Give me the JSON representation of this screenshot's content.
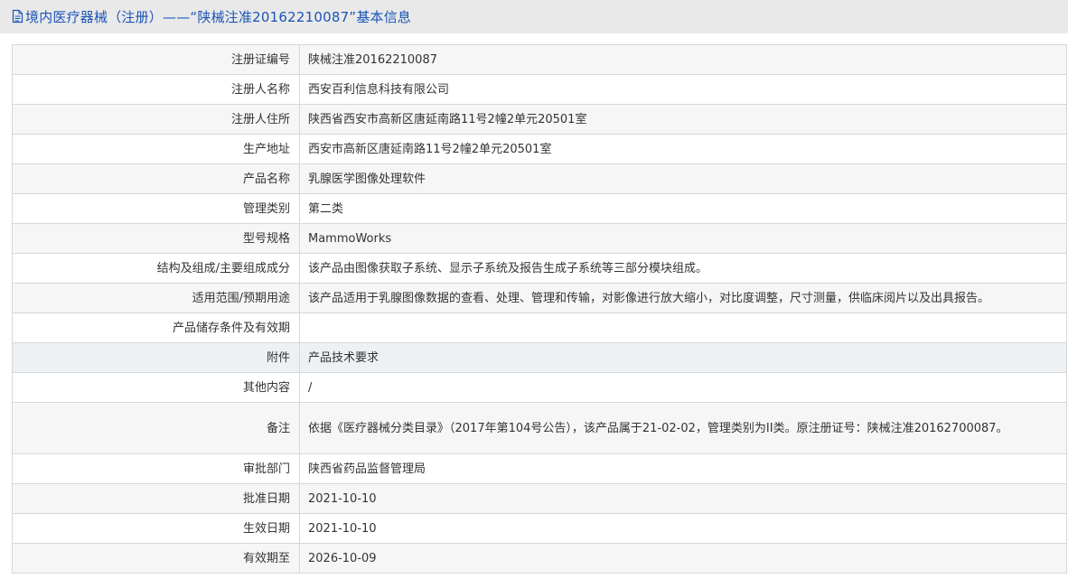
{
  "header": {
    "icon": "document-icon",
    "title": "境内医疗器械（注册）——“陕械注准20162210087”基本信息"
  },
  "rows": [
    {
      "label": "注册证编号",
      "value": "陕械注准20162210087"
    },
    {
      "label": "注册人名称",
      "value": "西安百利信息科技有限公司"
    },
    {
      "label": "注册人住所",
      "value": "陕西省西安市高新区唐延南路11号2幢2单元20501室"
    },
    {
      "label": "生产地址",
      "value": "西安市高新区唐延南路11号2幢2单元20501室"
    },
    {
      "label": "产品名称",
      "value": "乳腺医学图像处理软件"
    },
    {
      "label": "管理类别",
      "value": "第二类"
    },
    {
      "label": "型号规格",
      "value": "MammoWorks"
    },
    {
      "label": "结构及组成/主要组成成分",
      "value": "该产品由图像获取子系统、显示子系统及报告生成子系统等三部分模块组成。"
    },
    {
      "label": "适用范围/预期用途",
      "value": "该产品适用于乳腺图像数据的查看、处理、管理和传输，对影像进行放大缩小，对比度调整，尺寸测量，供临床阅片以及出具报告。"
    },
    {
      "label": "产品储存条件及有效期",
      "value": ""
    },
    {
      "label": "附件",
      "value": "产品技术要求"
    },
    {
      "label": "其他内容",
      "value": "/"
    },
    {
      "label": "备注",
      "value": "依据《医疗器械分类目录》（2017年第104号公告），该产品属于21-02-02，管理类别为II类。原注册证号：陕械注准20162700087。"
    },
    {
      "label": "审批部门",
      "value": "陕西省药品监督管理局"
    },
    {
      "label": "批准日期",
      "value": "2021-10-10"
    },
    {
      "label": "生效日期",
      "value": "2021-10-10"
    },
    {
      "label": "有效期至",
      "value": "2026-10-09"
    }
  ],
  "colors": {
    "header_bg": "#e9e9e9",
    "title": "#1a55b6",
    "border": "#d7d7d7",
    "row_odd": "#f6f6f6",
    "row_even": "#ffffff",
    "row_highlight": "#eef1f4"
  }
}
